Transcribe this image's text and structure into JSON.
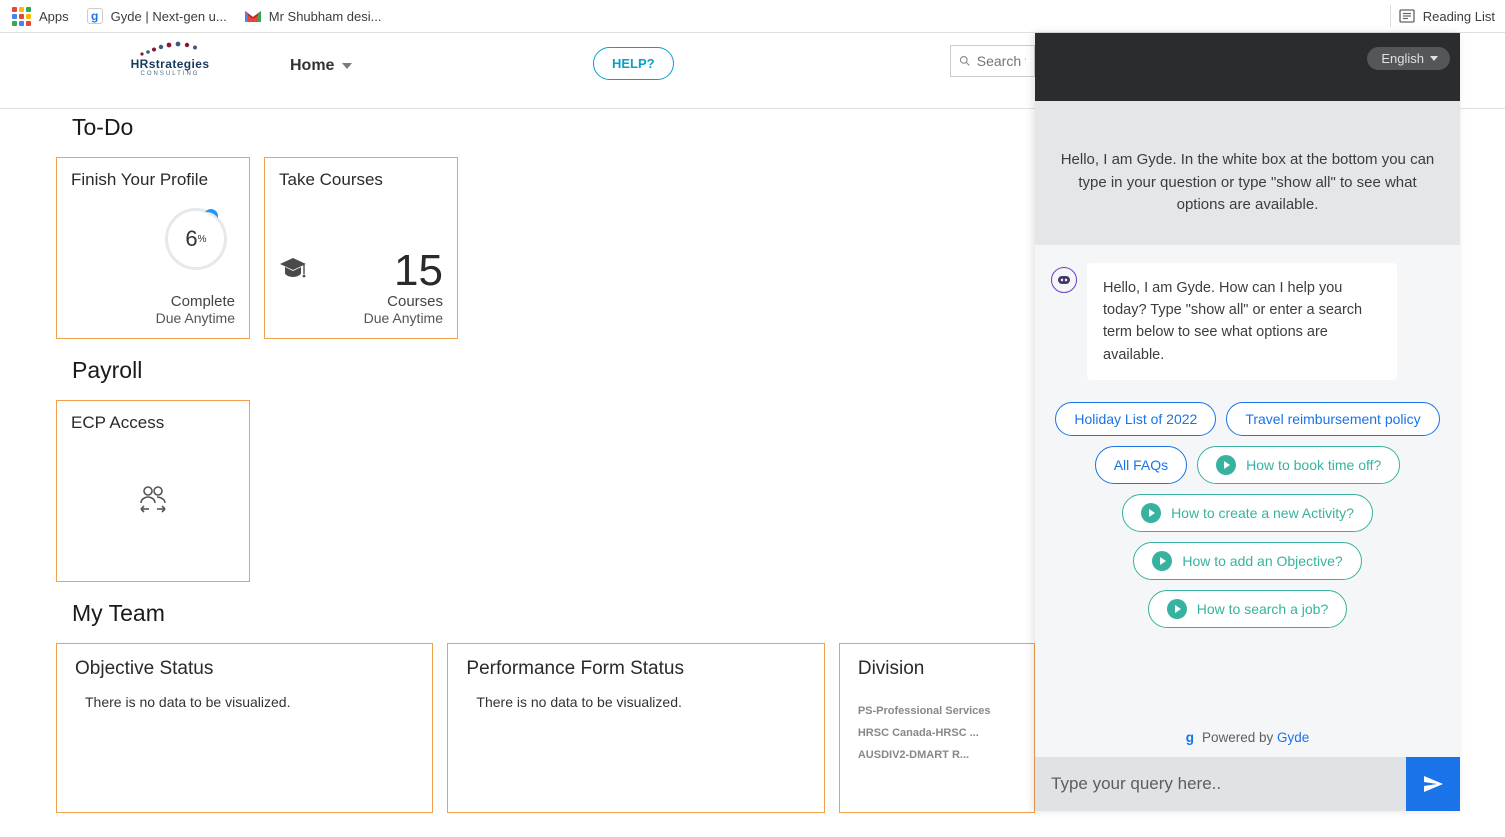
{
  "bookmarks": {
    "apps": "Apps",
    "gyde_tab": "Gyde | Next-gen u...",
    "gmail_tab": "Mr Shubham desi...",
    "reading_list": "Reading List"
  },
  "topbar": {
    "logo_main": "HRstrategies",
    "logo_sub": "CONSULTING",
    "home": "Home",
    "help": "HELP?",
    "search_placeholder": "Search fo"
  },
  "sections": {
    "todo": "To-Do",
    "payroll": "Payroll",
    "myteam": "My Team"
  },
  "todo": {
    "profile_card_title": "Finish Your Profile",
    "profile_percent": "6",
    "profile_percent_sign": "%",
    "profile_complete": "Complete",
    "profile_due": "Due Anytime",
    "course_card_title": "Take Courses",
    "course_count": "15",
    "course_label": "Courses",
    "course_due": "Due Anytime"
  },
  "payroll": {
    "ecp_title": "ECP Access"
  },
  "myteam": {
    "obj_title": "Objective Status",
    "perf_title": "Performance Form Status",
    "div_title": "Division",
    "no_data": "There is no data to be visualized.",
    "div_items": {
      "a": "PS-Professional Services",
      "b": "HRSC Canada-HRSC ...",
      "c": "AUSDIV2-DMART R..."
    }
  },
  "gyde": {
    "language": "English",
    "intro": "Hello, I am Gyde. In the white box at the bottom you can type in your question or type \"show all\" to see what options are available.",
    "bot_msg": "Hello, I am Gyde. How can I help you today? Type \"show all\" or enter a search term below to see what options are available.",
    "chips": {
      "holiday": "Holiday List of 2022",
      "travel": "Travel reimbursement policy",
      "faq": "All FAQs",
      "timeoff": "How to book time off?",
      "activity": "How to create a new Activity?",
      "objective": "How to add an Objective?",
      "job": "How to search a job?"
    },
    "powered_text": "Powered by ",
    "powered_link": "Gyde",
    "input_placeholder": "Type your query here.."
  }
}
